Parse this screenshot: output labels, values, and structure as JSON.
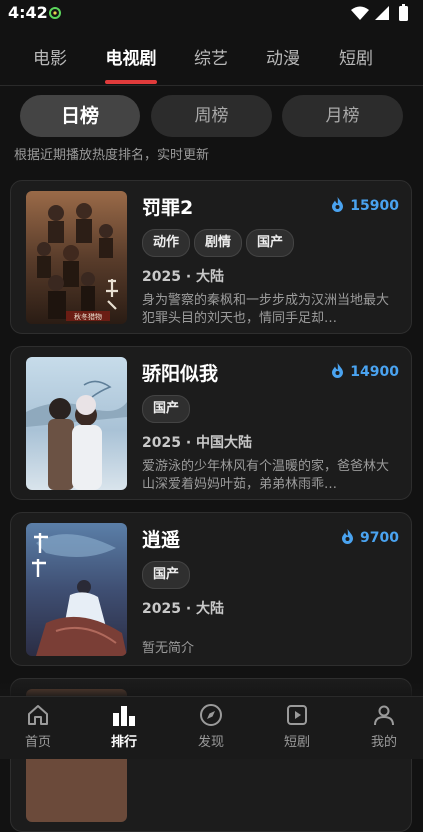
{
  "status_bar": {
    "time": "4:42"
  },
  "tabs": [
    {
      "label": "电影"
    },
    {
      "label": "电视剧",
      "active": true
    },
    {
      "label": "综艺"
    },
    {
      "label": "动漫"
    },
    {
      "label": "短剧"
    }
  ],
  "periods": [
    {
      "label": "日榜",
      "active": true
    },
    {
      "label": "周榜"
    },
    {
      "label": "月榜"
    }
  ],
  "hint": "根据近期播放热度排名，实时更新",
  "items": [
    {
      "title": "罚罪2",
      "heat": "15900",
      "tags": [
        "动作",
        "剧情",
        "国产"
      ],
      "meta": "2025 · 大陆",
      "desc": "身为警察的秦枫和一步步成为汉洲当地最大犯罪头目的刘天也，情同手足却…",
      "poster_text": "秋冬猎物"
    },
    {
      "title": "骄阳似我",
      "heat": "14900",
      "tags": [
        "国产"
      ],
      "meta": "2025 · 中国大陆",
      "desc": "爱游泳的少年林风有个温暖的家，爸爸林大山深爱着妈妈叶茹，弟弟林雨乖…"
    },
    {
      "title": "逍遥",
      "heat": "9700",
      "tags": [
        "国产"
      ],
      "meta": "2025 · 大陆",
      "desc": "暂无简介"
    }
  ],
  "bottom_nav": [
    {
      "label": "首页",
      "icon": "home-icon"
    },
    {
      "label": "排行",
      "icon": "ranking-icon",
      "active": true
    },
    {
      "label": "发现",
      "icon": "compass-icon"
    },
    {
      "label": "短剧",
      "icon": "play-icon"
    },
    {
      "label": "我的",
      "icon": "user-icon"
    }
  ],
  "colors": {
    "accent": "#e03b3b",
    "heat": "#4aa3f0",
    "background": "#121212"
  }
}
